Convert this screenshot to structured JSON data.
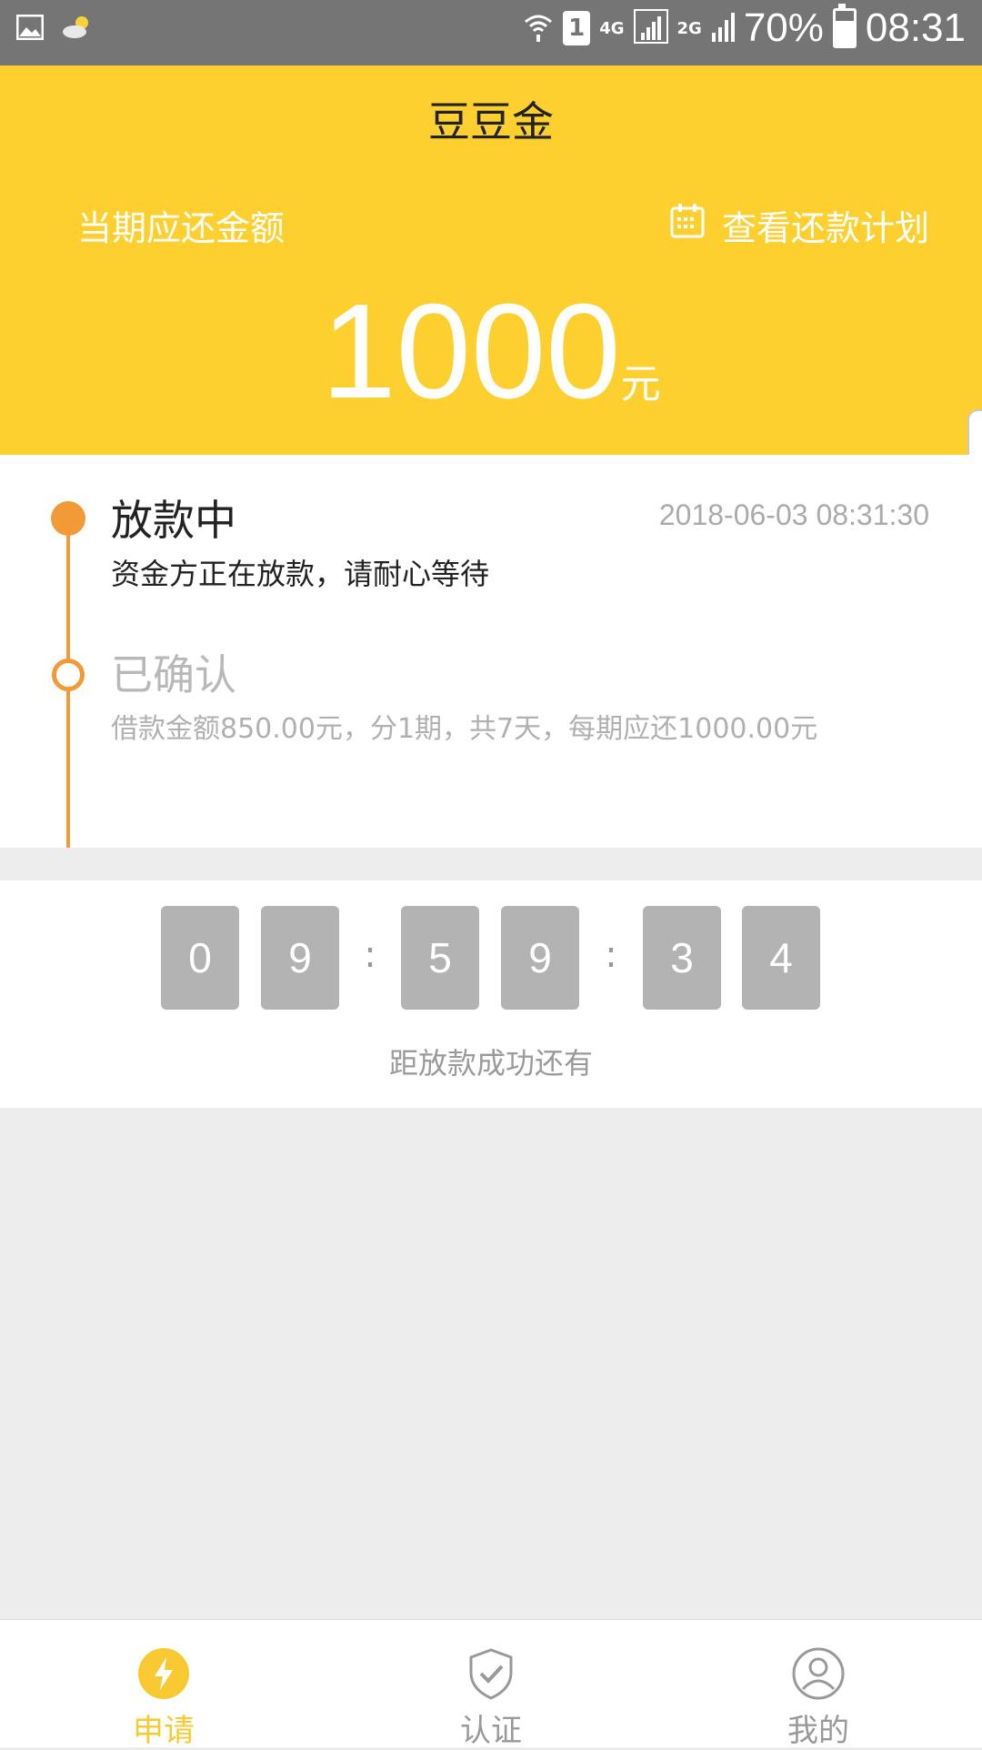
{
  "status_bar": {
    "network_4g": "4G",
    "network_2g": "2G",
    "sim": "1",
    "battery": "70%",
    "battery_level": 0.7,
    "time": "08:31"
  },
  "header": {
    "title": "豆豆金",
    "due_label": "当期应还金额",
    "plan_link": "查看还款计划",
    "amount": "1000",
    "unit": "元"
  },
  "timeline": [
    {
      "title": "放款中",
      "time": "2018-06-03 08:31:30",
      "desc": "资金方正在放款，请耐心等待"
    },
    {
      "title": "已确认",
      "desc": "借款金额850.00元，分1期，共7天，每期应还1000.00元"
    }
  ],
  "countdown": {
    "digits": [
      "0",
      "9",
      "5",
      "9",
      "3",
      "4"
    ],
    "separator": ":",
    "caption": "距放款成功还有"
  },
  "nav": {
    "items": [
      {
        "label": "申请",
        "icon": "lightning-icon",
        "active": true
      },
      {
        "label": "认证",
        "icon": "shield-check-icon",
        "active": false
      },
      {
        "label": "我的",
        "icon": "user-icon",
        "active": false
      }
    ]
  },
  "colors": {
    "brand_yellow": "#fdd02f",
    "timeline_orange": "#f39a38",
    "digit_gray": "#b3b3b3",
    "active_nav": "#f8c930"
  }
}
